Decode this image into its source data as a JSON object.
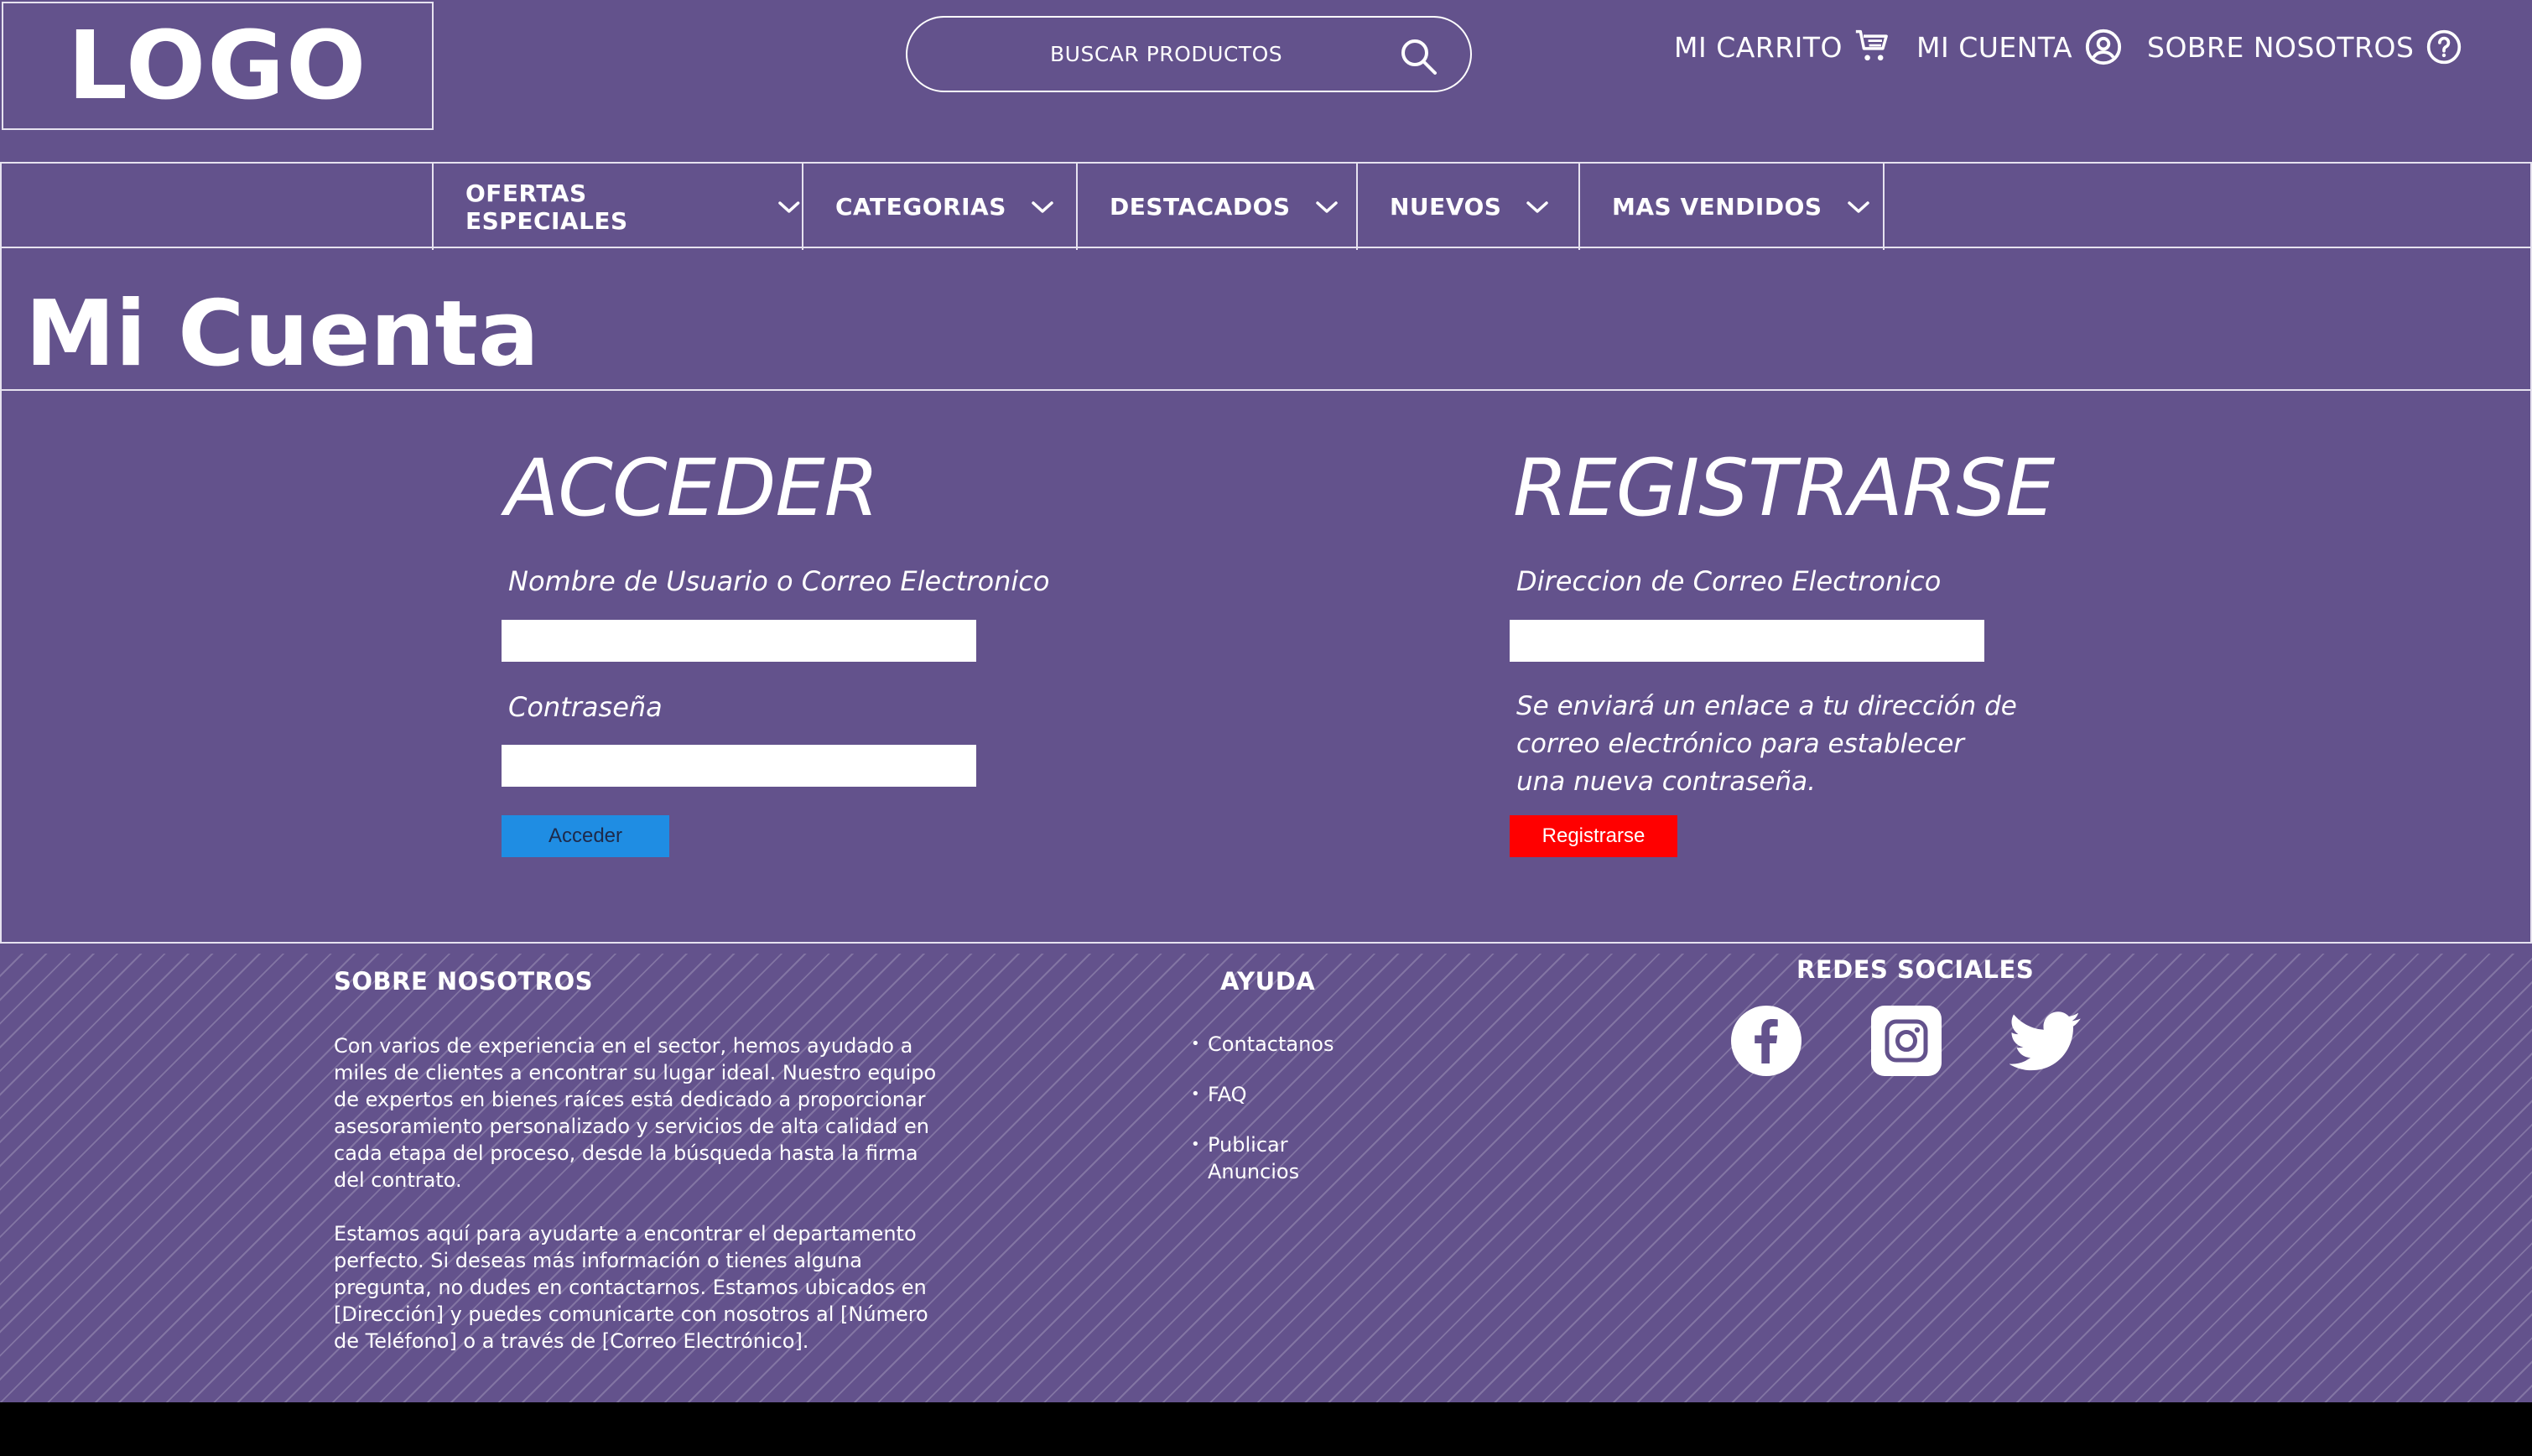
{
  "header": {
    "logo": "LOGO",
    "search": {
      "placeholder": "BUSCAR PRODUCTOS"
    },
    "links": {
      "cart": "MI CARRITO",
      "account": "MI CUENTA",
      "about": "SOBRE NOSOTROS"
    }
  },
  "nav": {
    "items": [
      {
        "label": "OFERTAS ESPECIALES"
      },
      {
        "label": "CATEGORIAS"
      },
      {
        "label": "DESTACADOS"
      },
      {
        "label": "NUEVOS"
      },
      {
        "label": "MAS VENDIDOS"
      }
    ]
  },
  "page": {
    "title": "Mi Cuenta"
  },
  "login": {
    "title": "ACCEDER",
    "user_label": "Nombre de Usuario o Correo Electronico",
    "password_label": "Contraseña",
    "button": "Acceder"
  },
  "register": {
    "title": "REGISTRARSE",
    "email_label": "Direccion de Correo Electronico",
    "note": "Se enviará un enlace a tu dirección de correo electrónico para establecer una nueva contraseña.",
    "button": "Registrarse"
  },
  "footer": {
    "about": {
      "heading": "SOBRE NOSOTROS",
      "p1": "Con varios de experiencia en el sector, hemos ayudado a miles de clientes a encontrar su lugar ideal. Nuestro equipo de expertos en bienes raíces está dedicado a proporcionar asesoramiento personalizado y servicios de alta calidad en cada etapa del proceso, desde la búsqueda hasta la firma del contrato.",
      "p2": "Estamos aquí para ayudarte a encontrar el departamento perfecto. Si deseas más información o tienes alguna pregunta, no dudes en contactarnos. Estamos ubicados en [Dirección] y puedes comunicarte con nosotros al [Número de Teléfono] o a través de [Correo Electrónico]."
    },
    "help": {
      "heading": "AYUDA",
      "items": [
        "Contactanos",
        "FAQ",
        "Publicar Anuncios"
      ]
    },
    "social": {
      "heading": "REDES SOCIALES",
      "icons": [
        "facebook-icon",
        "instagram-icon",
        "twitter-icon"
      ]
    }
  },
  "colors": {
    "background": "#63528c",
    "login_button": "#1f8de3",
    "register_button": "#ff0000"
  }
}
